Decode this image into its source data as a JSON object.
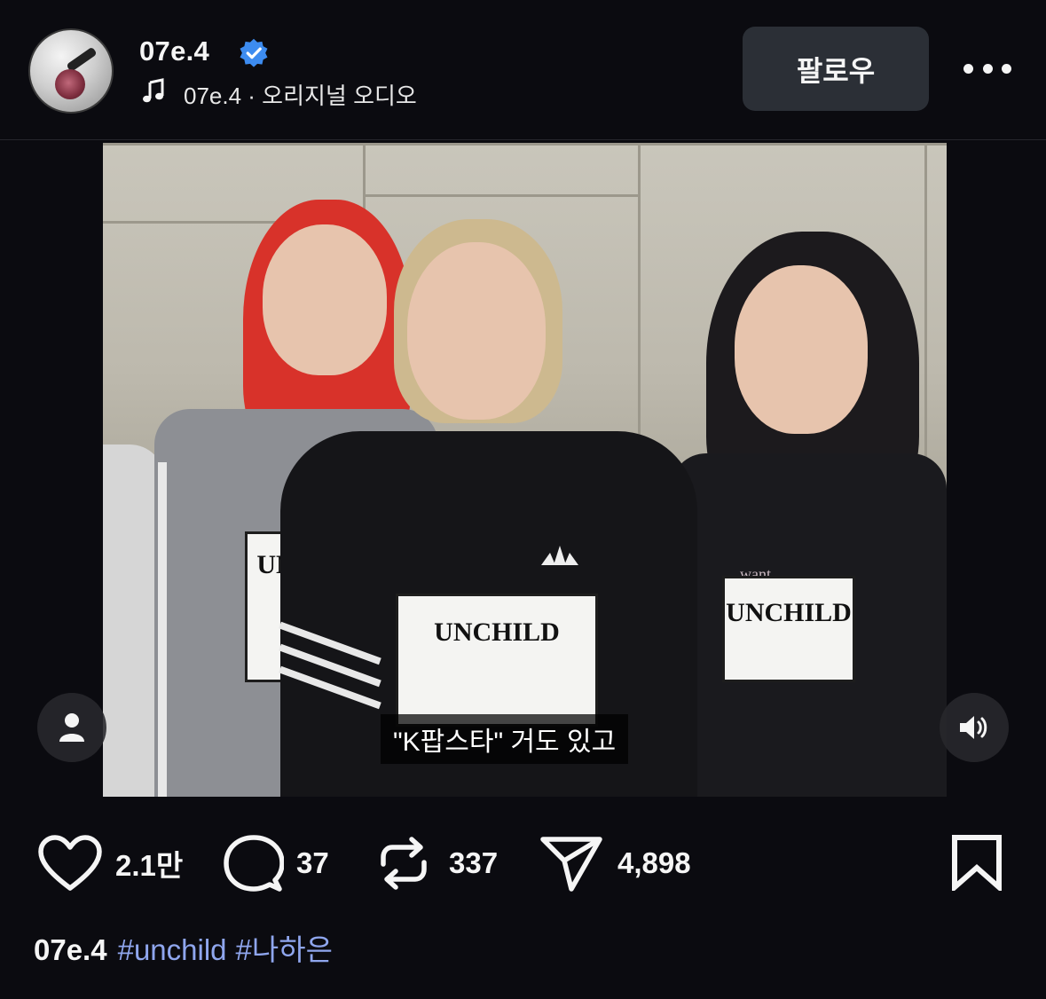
{
  "post": {
    "username": "07e.4",
    "verified": true,
    "audio": {
      "icon": "music-note-icon",
      "text": "07e.4 · 오리지널 오디오"
    },
    "follow_label": "팔로우",
    "more_icon": "more-horizontal-icon"
  },
  "video": {
    "subtitle": "\"K팝스타\" 거도 있고",
    "bibs": {
      "left": "UN",
      "center": "UNCHILD",
      "right": "UNCHILD",
      "right_small": "want to be"
    },
    "profile_icon": "person-icon",
    "volume_icon": "volume-on-icon"
  },
  "actions": {
    "likes": "2.1만",
    "comments": "37",
    "reposts": "337",
    "shares": "4,898"
  },
  "caption": {
    "username": "07e.4",
    "tags": [
      "#unchild",
      "#나하은"
    ]
  },
  "colors": {
    "background": "#0b0b10",
    "verified_blue": "#3d8cf0",
    "hashtag": "#8fa6ee",
    "follow_button": "#2b2f36"
  }
}
